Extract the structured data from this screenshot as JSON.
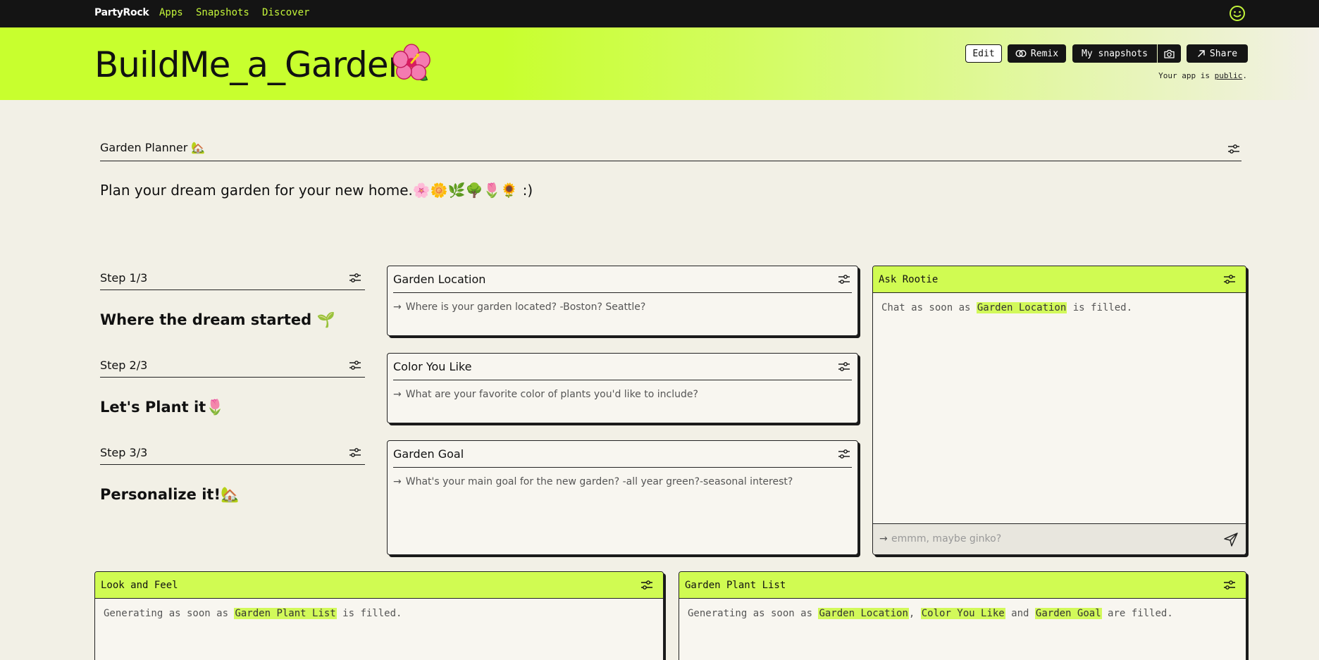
{
  "nav": {
    "brand": "PartyRock",
    "links": [
      "Apps",
      "Snapshots",
      "Discover"
    ]
  },
  "header": {
    "title": "BuildMe_a_Garden",
    "buttons": {
      "edit": "Edit",
      "remix": "Remix",
      "snapshots": "My snapshots",
      "share": "Share"
    },
    "public_prefix": "Your app is ",
    "public_link": "public",
    "public_suffix": "."
  },
  "section": {
    "heading": "Garden Planner 🏡",
    "description": "Plan your dream garden for your new home.🌸🌼🌿🌳🌷🌻 :)"
  },
  "steps": [
    {
      "label": "Step 1/3",
      "title": "Where the dream started 🌱"
    },
    {
      "label": "Step 2/3",
      "title": "Let's Plant it🌷"
    },
    {
      "label": "Step 3/3",
      "title": "Personalize it!🏡"
    }
  ],
  "inputs": [
    {
      "label": "Garden Location",
      "placeholder": "Where is your garden located? -Boston? Seattle?"
    },
    {
      "label": "Color You Like",
      "placeholder": "What are your favorite color of plants you'd like to include?"
    },
    {
      "label": "Garden Goal",
      "placeholder": "What's your main goal for the new garden? -all year green?-seasonal interest?"
    }
  ],
  "chat": {
    "label": "Ask Rootie",
    "status_prefix": "Chat as soon as ",
    "status_ref": "Garden Location",
    "status_suffix": " is filled.",
    "input_placeholder": "emmm, maybe ginko?"
  },
  "look_feel": {
    "label": "Look and Feel",
    "status_prefix": "Generating as soon as ",
    "status_ref": "Garden Plant List",
    "status_suffix": " is filled."
  },
  "plant_list": {
    "label": "Garden Plant List",
    "status_prefix": "Generating as soon as ",
    "ref1": "Garden Location",
    "sep1": ", ",
    "ref2": "Color You Like",
    "sep2": " and ",
    "ref3": "Garden Goal",
    "status_suffix": " are filled."
  },
  "colors": {
    "accent": "#c8ff2e",
    "highlight": "#d2f95a",
    "background": "#f2f0e6",
    "nav_bg": "#141414"
  }
}
